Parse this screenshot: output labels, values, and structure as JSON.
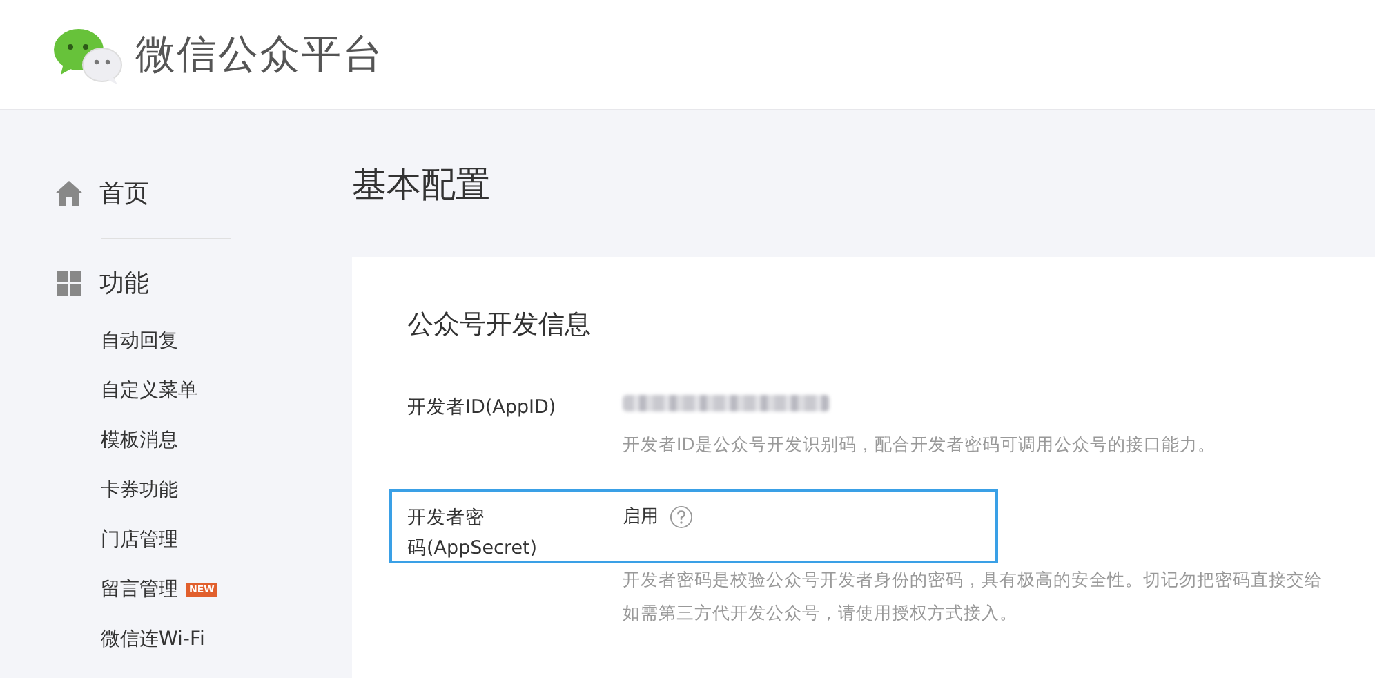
{
  "header": {
    "title": "微信公众平台"
  },
  "sidebar": {
    "home": {
      "label": "首页"
    },
    "section": {
      "label": "功能"
    },
    "items": [
      {
        "label": "自动回复"
      },
      {
        "label": "自定义菜单"
      },
      {
        "label": "模板消息"
      },
      {
        "label": "卡券功能"
      },
      {
        "label": "门店管理"
      },
      {
        "label": "留言管理",
        "badge": "NEW"
      },
      {
        "label": "微信连Wi-Fi"
      }
    ]
  },
  "page_title": "基本配置",
  "card": {
    "title": "公众号开发信息",
    "rows": [
      {
        "label": "开发者ID(AppID)",
        "value_blurred": true,
        "description_lines": [
          "开发者ID是公众号开发识别码，配合开发者密码可调用公众号的接口能力。"
        ]
      },
      {
        "label_lines": [
          "开发者密",
          "码(AppSecret)"
        ],
        "value": "启用",
        "help": true,
        "description_lines": [
          "开发者密码是校验公众号开发者身份的密码，具有极高的安全性。切记勿把密码直接交给",
          "如需第三方代开发公众号，请使用授权方式接入。"
        ],
        "highlighted": true
      }
    ]
  }
}
